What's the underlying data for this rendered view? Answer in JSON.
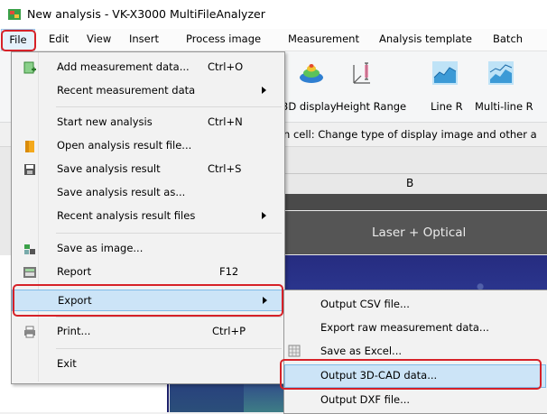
{
  "window": {
    "title": "New analysis - VK-X3000 MultiFileAnalyzer"
  },
  "menubar": {
    "items": [
      {
        "label": "File"
      },
      {
        "label": "Edit"
      },
      {
        "label": "View"
      },
      {
        "label": "Insert"
      },
      {
        "label": "Process image"
      },
      {
        "label": "Measurement"
      },
      {
        "label": "Analysis template"
      },
      {
        "label": "Batch"
      }
    ]
  },
  "ribbon": {
    "labels": [
      "3D display",
      "Height Range",
      "Line R",
      "Multi-line R"
    ]
  },
  "infobar": {
    "text": "n cell: Change type of display image and other a"
  },
  "grid": {
    "column_b": "B",
    "cell_title": "Laser + Optical"
  },
  "file_menu": {
    "items": [
      {
        "label": "Add measurement data...",
        "shortcut": "Ctrl+O",
        "icon": "add-data-icon"
      },
      {
        "label": "Recent measurement data",
        "shortcut": "",
        "submenu": true
      },
      {
        "label": "Start new analysis",
        "shortcut": "Ctrl+N"
      },
      {
        "label": "Open analysis result file...",
        "shortcut": "",
        "icon": "folder-icon"
      },
      {
        "label": "Save analysis result",
        "shortcut": "Ctrl+S",
        "icon": "save-icon"
      },
      {
        "label": "Save analysis result as...",
        "shortcut": ""
      },
      {
        "label": "Recent analysis result files",
        "shortcut": "",
        "submenu": true
      },
      {
        "label": "Save as image...",
        "shortcut": "",
        "icon": "save-image-icon"
      },
      {
        "label": "Report",
        "shortcut": "F12",
        "icon": "report-icon"
      },
      {
        "label": "Export",
        "shortcut": "",
        "submenu": true
      },
      {
        "label": "Print...",
        "shortcut": "Ctrl+P",
        "icon": "printer-icon"
      },
      {
        "label": "Exit",
        "shortcut": ""
      }
    ]
  },
  "export_submenu": {
    "items": [
      {
        "label": "Output CSV file..."
      },
      {
        "label": "Export raw measurement data..."
      },
      {
        "label": "Save as Excel...",
        "icon": "excel-icon"
      },
      {
        "label": "Output 3D-CAD data..."
      },
      {
        "label": "Output DXF file..."
      }
    ]
  },
  "colors": {
    "highlight": "#cce4f7",
    "highlight_border": "#7fbbe8",
    "annotation_red": "#d62128"
  }
}
